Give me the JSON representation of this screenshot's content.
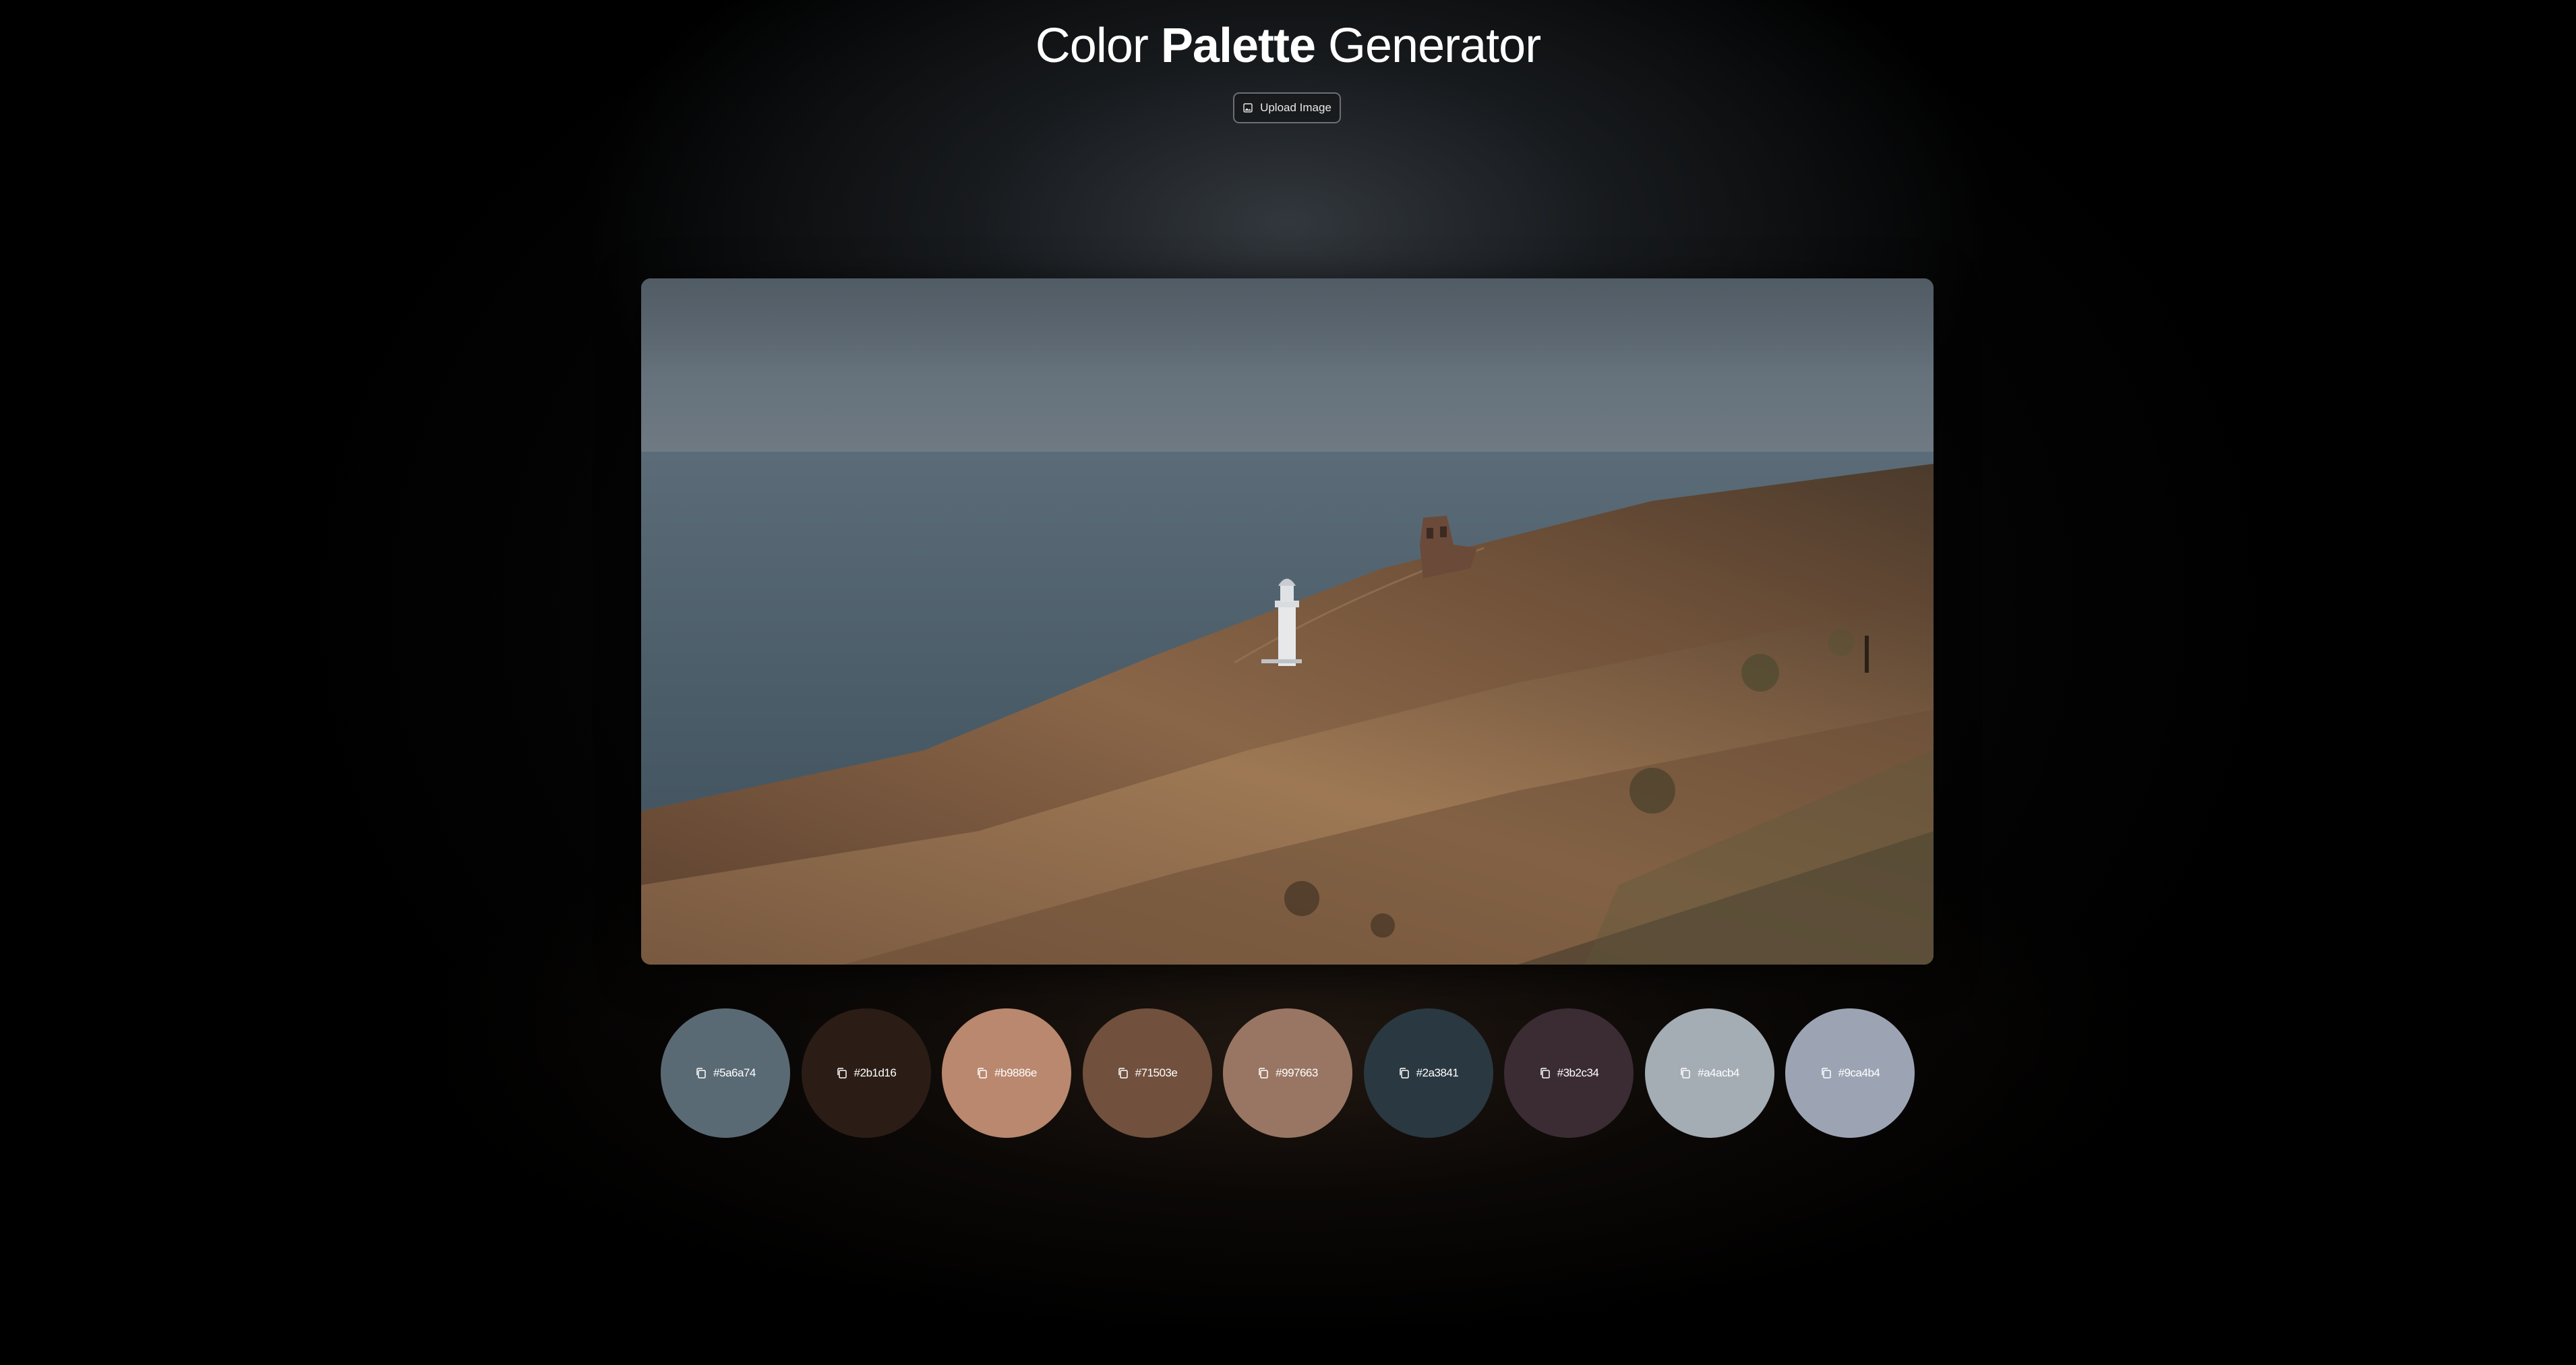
{
  "header": {
    "title_part1": "Color",
    "title_bold": "Palette",
    "title_part2": "Generator",
    "upload_label": "Upload Image",
    "upload_icon": "image-icon"
  },
  "image": {
    "description_icon": "landscape-photo"
  },
  "palette": {
    "copy_icon": "copy-icon",
    "swatches": [
      {
        "hex": "#5a6a74",
        "color": "#5a6a74"
      },
      {
        "hex": "#2b1d16",
        "color": "#2b1d16"
      },
      {
        "hex": "#b9886e",
        "color": "#b9886e"
      },
      {
        "hex": "#71503e",
        "color": "#71503e"
      },
      {
        "hex": "#997663",
        "color": "#997663"
      },
      {
        "hex": "#2a3841",
        "color": "#2a3841"
      },
      {
        "hex": "#3b2c34",
        "color": "#3b2c34"
      },
      {
        "hex": "#a4acb4",
        "color": "#a4acb4"
      },
      {
        "hex": "#9ca4b4",
        "color": "#9ca4b4"
      }
    ]
  }
}
